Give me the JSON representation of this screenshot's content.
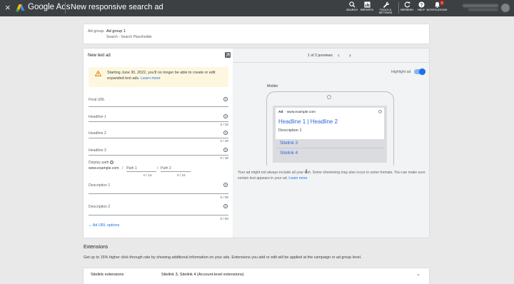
{
  "header": {
    "close": "×",
    "brand": "Google Ads",
    "title": "New responsive search ad",
    "actions": {
      "search": "SEARCH",
      "reports": "REPORTS",
      "tools_line1": "TOOLS &",
      "tools_line2": "SETTINGS",
      "refresh": "REFRESH",
      "help": "HELP",
      "notifications": "NOTIFICATIONS",
      "notification_count": "1"
    }
  },
  "ad_group": {
    "label": "Ad group",
    "name": "Ad group 1",
    "campaign": "Search - Search Placeholder"
  },
  "form": {
    "heading": "New text ad",
    "warning_text": "Starting June 30, 2022, you'll no longer be able to create or edit expanded text ads.",
    "warning_link": "Learn more",
    "final_url_label": "Final URL",
    "headline1_label": "Headline 1",
    "headline1_count": "0 / 30",
    "headline2_label": "Headline 2",
    "headline2_count": "0 / 30",
    "headline3_label": "Headline 3",
    "headline3_count": "0 / 30",
    "display_path_label": "Display path",
    "display_domain": "www.example.com",
    "path_sep1": "/",
    "path1_placeholder": "Path 1",
    "path_sep2": "/",
    "path2_placeholder": "Path 2",
    "path1_count": "0 / 15",
    "path2_count": "0 / 15",
    "description1_label": "Description 1",
    "description1_count": "0 / 90",
    "description2_label": "Description 2",
    "description2_count": "0 / 90",
    "ad_url_options": "Ad URL options",
    "help_glyph": "?"
  },
  "preview": {
    "count": "1 of 2 previews",
    "prev": "‹",
    "next": "›",
    "highlight_label": "Highlight ad",
    "highlight_on": true,
    "device_label": "Mobile",
    "ad_tag": "Ad",
    "ad_url": "· www.example.com",
    "headline": "Headline 1 | Headline 2",
    "description": "Description 1",
    "sitelinks": [
      "Sitelink 3",
      "Sitelink 4"
    ],
    "note": "Your ad might not always include all your text. Some shortening may also occur in some formats. You can make sure certain text appears in your ad.",
    "note_link": "Learn more"
  },
  "extensions": {
    "title": "Extensions",
    "description": "Get up to 15% higher click through rate by showing additional information on your ads. Extensions you add or edit will be applied at the campaign or ad group level.",
    "sitelink_label": "Sitelink extensions",
    "sitelink_value": "Sitelink 3, Sitelink 4 (Account-level extensions)",
    "chevron": "⌄"
  },
  "colors": {
    "topbar": "#3c4043",
    "link": "#1a73e8",
    "warning_bg": "#fef7e0",
    "warning_icon": "#e37400",
    "ad_headline": "#3367d6"
  }
}
